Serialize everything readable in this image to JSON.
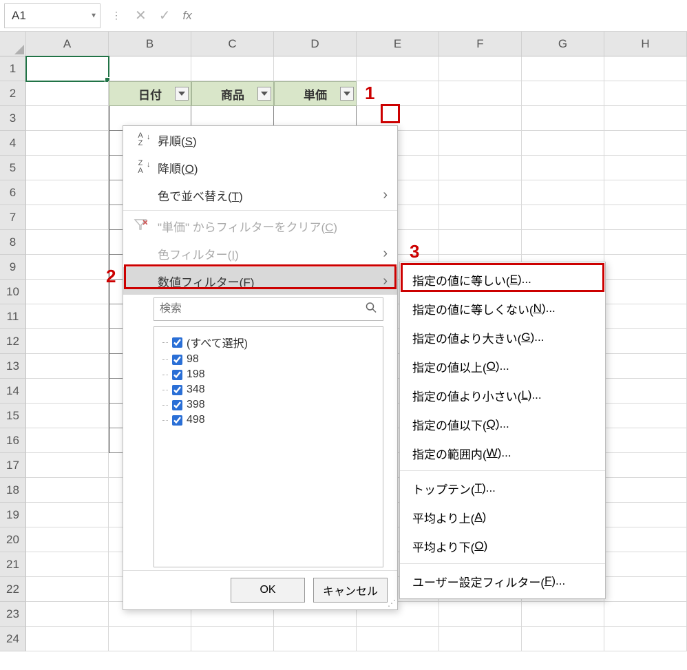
{
  "formula_bar": {
    "namebox": "A1",
    "cancel_icon": "✕",
    "confirm_icon": "✓",
    "fx_label": "fx",
    "formula_value": ""
  },
  "columns": [
    "A",
    "B",
    "C",
    "D",
    "E",
    "F",
    "G",
    "H"
  ],
  "rows": [
    1,
    2,
    3,
    4,
    5,
    6,
    7,
    8,
    9,
    10,
    11,
    12,
    13,
    14,
    15,
    16,
    17,
    18,
    19,
    20,
    21,
    22,
    23,
    24
  ],
  "table": {
    "headers": [
      "日付",
      "商品",
      "単価"
    ]
  },
  "filter_menu": {
    "sort_asc": "昇順(S)",
    "sort_desc": "降順(O)",
    "sort_color": "色で並べ替え(T)",
    "clear_filter": "\"単価\" からフィルターをクリア(C)",
    "color_filter": "色フィルター(I)",
    "number_filter": "数値フィルター(F)",
    "search_placeholder": "検索",
    "check_items": [
      "(すべて選択)",
      "98",
      "198",
      "348",
      "398",
      "498"
    ],
    "ok_label": "OK",
    "cancel_label": "キャンセル"
  },
  "sub_menu": {
    "items_group1": [
      "指定の値に等しい(E)...",
      "指定の値に等しくない(N)...",
      "指定の値より大きい(G)...",
      "指定の値以上(O)...",
      "指定の値より小さい(L)...",
      "指定の値以下(Q)...",
      "指定の範囲内(W)..."
    ],
    "items_group2": [
      "トップテン(T)...",
      "平均より上(A)",
      "平均より下(O)"
    ],
    "items_group3": [
      "ユーザー設定フィルター(F)..."
    ]
  },
  "callouts": {
    "one": "1",
    "two": "2",
    "three": "3"
  },
  "icons": {
    "sort_asc": "A↓Z",
    "sort_desc": "Z↓A",
    "clear_funnel": "⧩"
  }
}
